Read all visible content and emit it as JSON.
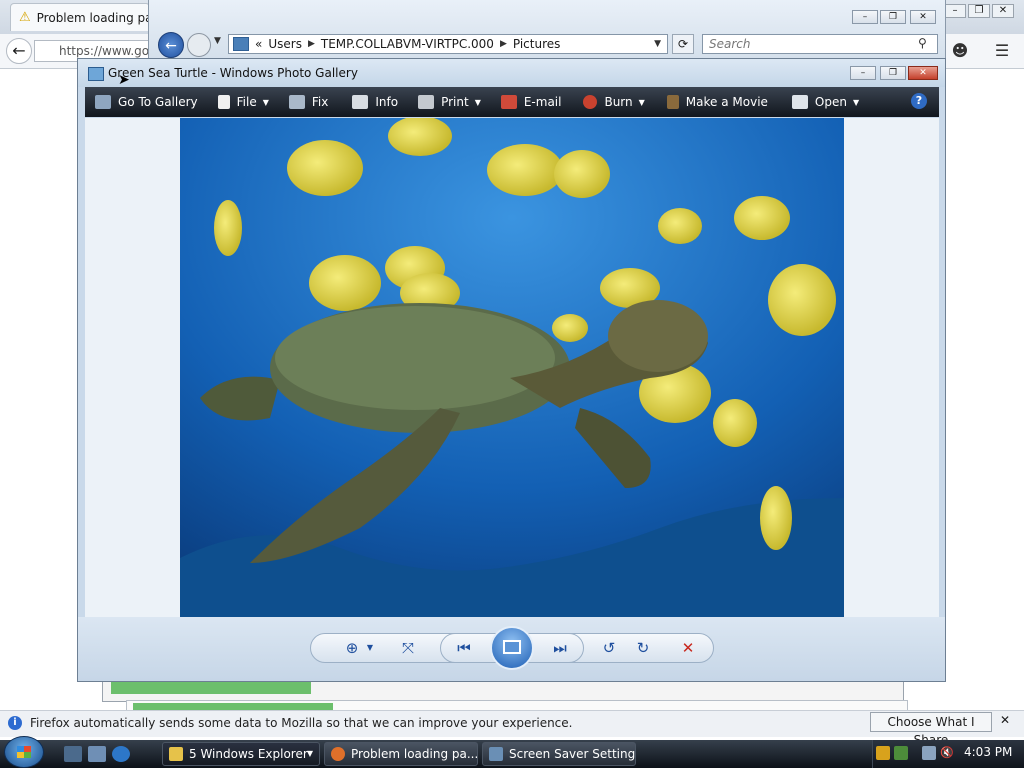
{
  "firefox": {
    "tab_title": "Problem loading pa",
    "url_text": "https://www.goo",
    "notice_text": "Firefox automatically sends some data to Mozilla so that we can improve your experience.",
    "share_button": "Choose What I Share"
  },
  "explorer": {
    "address_prefix": "«",
    "crumbs": [
      "Users",
      "TEMP.COLLABVM-VIRTPC.000",
      "Pictures"
    ],
    "search_placeholder": "Search"
  },
  "photo_gallery": {
    "window_title": "Green Sea Turtle - Windows Photo Gallery",
    "toolbar": {
      "go_to_gallery": "Go To Gallery",
      "file": "File",
      "fix": "Fix",
      "info": "Info",
      "print": "Print",
      "email": "E-mail",
      "burn": "Burn",
      "make_movie": "Make a Movie",
      "open": "Open",
      "help": "?"
    }
  },
  "taskbar": {
    "tasks": [
      {
        "label": "5 Windows Explorer"
      },
      {
        "label": "Problem loading pa..."
      },
      {
        "label": "Screen Saver Settings"
      }
    ],
    "clock": "4:03 PM"
  },
  "colors": {
    "toolbar_bg": "#1b222c",
    "photo_water": "#1665b8",
    "fish_yellow": "#e2d64a"
  }
}
